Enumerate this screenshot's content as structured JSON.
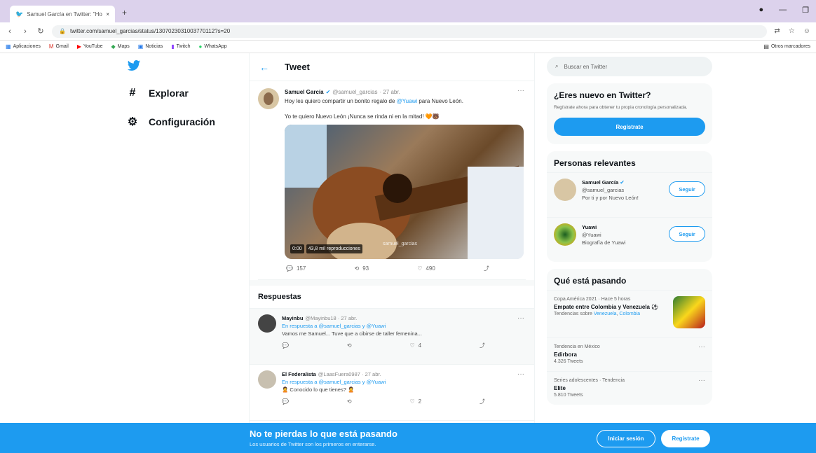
{
  "browser": {
    "tab_title": "Samuel García en Twitter: \"Hoy ...",
    "tab_close": "×",
    "new_tab": "+",
    "url": "twitter.com/samuel_garcias/status/1307023031003770112?s=20",
    "bookmarks": [
      {
        "icon": "apps-icon",
        "label": "Aplicaciones"
      },
      {
        "icon": "gmail-icon",
        "label": "Gmail"
      },
      {
        "icon": "youtube-icon",
        "label": "YouTube"
      },
      {
        "icon": "maps-icon",
        "label": "Maps"
      },
      {
        "icon": "news-icon",
        "label": "Noticias"
      },
      {
        "icon": "twitch-icon",
        "label": "Twitch"
      },
      {
        "icon": "whatsapp-icon",
        "label": "WhatsApp"
      }
    ],
    "bookmarks_right": "Otros marcadores"
  },
  "leftnav": {
    "explore": "Explorar",
    "settings": "Configuración"
  },
  "header": {
    "title": "Tweet"
  },
  "tweet": {
    "name": "Samuel García",
    "handle": "@samuel_garcias",
    "date": "· 27 abr.",
    "text_pre": "Hoy les quiero compartir un bonito regalo de ",
    "text_mention": "@Yuawi",
    "text_post": " para Nuevo León.",
    "text2": "Yo te quiero Nuevo León ¡Nunca se rinda ni en la mitad! 🧡🐻",
    "caption_time": "0:00",
    "caption_views": "43,8 mil reproducciones",
    "watermark": "samuel_garcias",
    "replies": "157",
    "retweets": "93",
    "likes": "490"
  },
  "replies_section": "Respuestas",
  "replies": [
    {
      "name": "Mayinbu",
      "handle": "@Mayinbu18 · 27 abr.",
      "replying": "En respuesta a @samuel_garcias y @Yuawi",
      "text": "Vamos me Samuel... Tuve que a cibirse de taller femenina...",
      "comments": "",
      "retweets": "",
      "likes": "4"
    },
    {
      "name": "El Federalista",
      "handle": "@LaasFuera0987 · 27 abr.",
      "replying": "En respuesta a @samuel_garcias y @Yuawi",
      "text": "🙎 Conocido lo que tienes? 🙎",
      "comments": "",
      "retweets": "",
      "likes": "2"
    }
  ],
  "right": {
    "search_placeholder": "Buscar en Twitter",
    "new_title": "¿Eres nuevo en Twitter?",
    "new_desc": "Regístrate ahora para obtener tu propia cronología personalizada.",
    "register": "Regístrate",
    "people_title": "Personas relevantes",
    "people": [
      {
        "name": "Samuel García",
        "handle": "@samuel_garcias",
        "bio": "Por ti y por Nuevo León!",
        "follow": "Seguir"
      },
      {
        "name": "Yuawi",
        "handle": "@Yuawi",
        "bio": "Biografía de Yuawi",
        "follow": "Seguir"
      }
    ],
    "trends_title": "Qué está pasando",
    "trends": [
      {
        "context": "Copa América 2021 · Hace 5 horas",
        "title": "Empate entre Colombia y Venezuela ⚽",
        "tags_prefix": "Tendencias sobre ",
        "tag1": "Venezuela",
        "tag2": "Colombia"
      },
      {
        "context": "Tendencia en México",
        "title": "Edirbora",
        "count": "4.326 Tweets"
      },
      {
        "context": "Series adolescentes · Tendencia",
        "title": "Elite",
        "count": "5.810 Tweets"
      }
    ]
  },
  "banner": {
    "title": "No te pierdas lo que está pasando",
    "subtitle": "Los usuarios de Twitter son los primeros en enterarse.",
    "login": "Iniciar sesión",
    "register": "Regístrate"
  },
  "colors": {
    "twitter_blue": "#1d9bf0",
    "tabbar": "#dcd2ec"
  }
}
